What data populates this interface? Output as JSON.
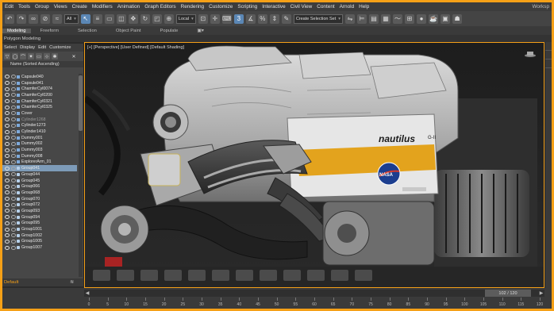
{
  "menu": {
    "items": [
      "Edit",
      "Tools",
      "Group",
      "Views",
      "Create",
      "Modifiers",
      "Animation",
      "Graph Editors",
      "Rendering",
      "Customize",
      "Scripting",
      "Interactive",
      "Civil View",
      "Content",
      "Arnold",
      "Help"
    ],
    "right_label": "Worksp"
  },
  "toolbar": {
    "filter_dropdown": "All",
    "coord_dropdown": "Local",
    "selection_set_dropdown": "Create Selection Set"
  },
  "ribbon": {
    "tabs": [
      "Modeling",
      "Freeform",
      "Selection",
      "Object Paint",
      "Populate"
    ],
    "active": "Modeling",
    "sub_label": "Polygon Modeling"
  },
  "explorer": {
    "menu": [
      "Select",
      "Display",
      "Edit",
      "Customize"
    ],
    "column_header": "Name (Sorted Ascending)",
    "items": [
      {
        "name": "Capsule040",
        "type": "obj"
      },
      {
        "name": "Capsule041",
        "type": "obj"
      },
      {
        "name": "ChamferCyl0074",
        "type": "obj"
      },
      {
        "name": "ChamferCyl0200",
        "type": "obj"
      },
      {
        "name": "ChamferCyl0321",
        "type": "obj"
      },
      {
        "name": "ChamferCyl0325",
        "type": "obj"
      },
      {
        "name": "Cover",
        "type": "obj"
      },
      {
        "name": "Cylinder1268",
        "type": "obj",
        "dim": true
      },
      {
        "name": "Cylinder1273",
        "type": "obj"
      },
      {
        "name": "Cylinder1410",
        "type": "obj"
      },
      {
        "name": "Dummy001",
        "type": "obj"
      },
      {
        "name": "Dummy002",
        "type": "obj"
      },
      {
        "name": "Dummy003",
        "type": "obj"
      },
      {
        "name": "Dummy008",
        "type": "obj"
      },
      {
        "name": "ExplorerArm_01",
        "type": "obj"
      },
      {
        "name": "Group041",
        "type": "grp",
        "selected": true
      },
      {
        "name": "Group044",
        "type": "grp"
      },
      {
        "name": "Group045",
        "type": "grp"
      },
      {
        "name": "Group066",
        "type": "grp"
      },
      {
        "name": "Group068",
        "type": "grp"
      },
      {
        "name": "Group070",
        "type": "grp"
      },
      {
        "name": "Group072",
        "type": "grp"
      },
      {
        "name": "Group093",
        "type": "grp"
      },
      {
        "name": "Group094",
        "type": "grp"
      },
      {
        "name": "Group095",
        "type": "grp"
      },
      {
        "name": "Group1001",
        "type": "grp"
      },
      {
        "name": "Group1002",
        "type": "grp"
      },
      {
        "name": "Group1005",
        "type": "grp"
      },
      {
        "name": "Group1007",
        "type": "grp"
      }
    ],
    "layer_label": "Default"
  },
  "viewport": {
    "label": "[+] [Perspective] [User Defined] [Default Shading]",
    "decal_name": "nautilus",
    "decal_suffix": "G-II"
  },
  "timeline": {
    "frame_display": "102 / 120",
    "ticks": [
      "0",
      "5",
      "10",
      "15",
      "20",
      "25",
      "30",
      "35",
      "40",
      "45",
      "50",
      "55",
      "60",
      "65",
      "70",
      "75",
      "80",
      "85",
      "90",
      "95",
      "100",
      "105",
      "110",
      "115",
      "120"
    ]
  },
  "colors": {
    "frame_accent": "#f5a017",
    "selection": "#7d9bb8",
    "active_tool": "#5b87b5"
  }
}
